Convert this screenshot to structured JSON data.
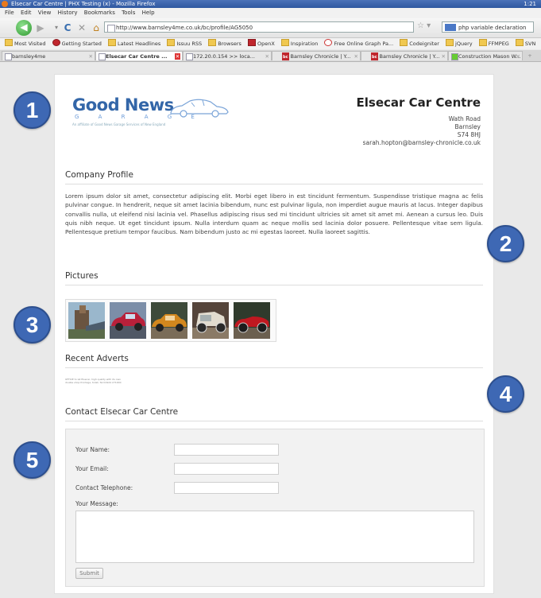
{
  "browser": {
    "window_title": "Elsecar Car Centre | PHX Testing (x) - Mozilla Firefox",
    "window_title_right": "1:21",
    "menu": [
      "File",
      "Edit",
      "View",
      "History",
      "Bookmarks",
      "Tools",
      "Help"
    ],
    "url": "http://www.barnsley4me.co.uk/bc/profile/AG5050",
    "search_text": "php variable declaration",
    "bookmarks": [
      "Most Visited",
      "Getting Started",
      "Latest Headlines",
      "Issuu RSS",
      "Browsers",
      "OpenX",
      "Inspiration",
      "Free Online Graph Pa...",
      "Codeigniter",
      "jQuery",
      "FFMPEG",
      "SVN"
    ],
    "tabs": [
      {
        "label": "barnsley4me",
        "badge": ""
      },
      {
        "label": "Elsecar Car Centre ...",
        "badge": ""
      },
      {
        "label": "172.20.0.154 >> loca...",
        "badge": ""
      },
      {
        "label": "Barnsley Chronicle | Y...",
        "badge": "bc"
      },
      {
        "label": "Barnsley Chronicle | Y...",
        "badge": "bc"
      },
      {
        "label": "Construction Mason W...",
        "badge": ""
      }
    ]
  },
  "page": {
    "logo": {
      "main": "Good News",
      "sub": "G A R A G E",
      "tagline": "An affiliate of Good News Garage Services of New England"
    },
    "business_name": "Elsecar Car Centre",
    "address": [
      "Wath Road",
      "Barnsley",
      "S74 8HJ",
      "sarah.hopton@barnsley-chronicle.co.uk"
    ],
    "company_profile_heading": "Company Profile",
    "company_profile_text": "Lorem ipsum dolor sit amet, consectetur adipiscing elit. Morbi eget libero in est tincidunt fermentum. Suspendisse tristique magna ac felis pulvinar congue. In hendrerit, neque sit amet lacinia bibendum, nunc est pulvinar ligula, non imperdiet augue mauris at lacus. Integer dapibus convallis nulla, ut eleifend nisi lacinia vel. Phasellus adipiscing risus sed mi tincidunt ultricies sit amet sit amet mi. Aenean a cursus leo. Duis quis nibh neque. Ut eget tincidunt ipsum. Nulla interdum quam ac neque mollis sed lacinia dolor posuere. Pellentesque vitae sem ligula. Pellentesque pretium tempor faucibus. Nam bibendum justo ac mi egestas laoreet. Nulla laoreet sagittis.",
    "pictures_heading": "Pictures",
    "recent_adverts_heading": "Recent Adverts",
    "advert_text": "OFFICE to let Elsecar, high quality with its own double shop frontage, toilet, Tel 01924 271000",
    "contact_heading": "Contact Elsecar Car Centre",
    "form": {
      "name_label": "Your Name:",
      "email_label": "Your Email:",
      "phone_label": "Contact Telephone:",
      "message_label": "Your Message:",
      "submit_label": "Submit"
    }
  },
  "callouts": [
    "1",
    "2",
    "3",
    "4",
    "5"
  ],
  "colors": {
    "callout": "#3e68b4",
    "logo": "#3366a8"
  }
}
